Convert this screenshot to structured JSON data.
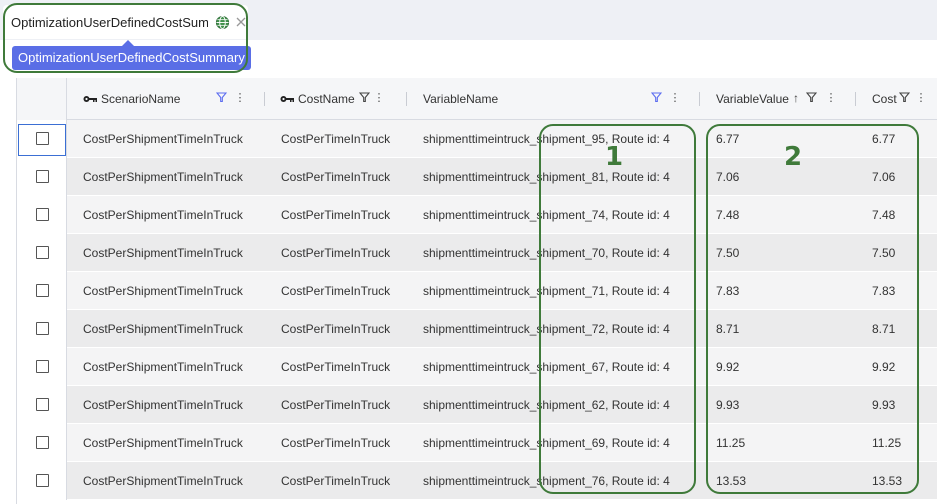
{
  "tab": {
    "title": "OptimizationUserDefinedCostSumr",
    "tooltip": "OptimizationUserDefinedCostSummary"
  },
  "columns": {
    "scenario": "ScenarioName",
    "cost_name": "CostName",
    "variable_name": "VariableName",
    "variable_value": "VariableValue",
    "cost": "Cost"
  },
  "icons": {
    "key": "key-icon",
    "filter": "filter-icon",
    "menu": "vertical-ellipsis-icon",
    "sort": "sort-ascending-icon",
    "globe": "globe-icon",
    "close": "close-icon"
  },
  "rows": [
    {
      "scenario": "CostPerShipmentTimeInTruck",
      "cost_name": "CostPerTimeInTruck",
      "variable_name": "shipmenttimeintruck_shipment_95, Route id: 4",
      "variable_value": "6.77",
      "cost": "6.77"
    },
    {
      "scenario": "CostPerShipmentTimeInTruck",
      "cost_name": "CostPerTimeInTruck",
      "variable_name": "shipmenttimeintruck_shipment_81, Route id: 4",
      "variable_value": "7.06",
      "cost": "7.06"
    },
    {
      "scenario": "CostPerShipmentTimeInTruck",
      "cost_name": "CostPerTimeInTruck",
      "variable_name": "shipmenttimeintruck_shipment_74, Route id: 4",
      "variable_value": "7.48",
      "cost": "7.48"
    },
    {
      "scenario": "CostPerShipmentTimeInTruck",
      "cost_name": "CostPerTimeInTruck",
      "variable_name": "shipmenttimeintruck_shipment_70, Route id: 4",
      "variable_value": "7.50",
      "cost": "7.50"
    },
    {
      "scenario": "CostPerShipmentTimeInTruck",
      "cost_name": "CostPerTimeInTruck",
      "variable_name": "shipmenttimeintruck_shipment_71, Route id: 4",
      "variable_value": "7.83",
      "cost": "7.83"
    },
    {
      "scenario": "CostPerShipmentTimeInTruck",
      "cost_name": "CostPerTimeInTruck",
      "variable_name": "shipmenttimeintruck_shipment_72, Route id: 4",
      "variable_value": "8.71",
      "cost": "8.71"
    },
    {
      "scenario": "CostPerShipmentTimeInTruck",
      "cost_name": "CostPerTimeInTruck",
      "variable_name": "shipmenttimeintruck_shipment_67, Route id: 4",
      "variable_value": "9.92",
      "cost": "9.92"
    },
    {
      "scenario": "CostPerShipmentTimeInTruck",
      "cost_name": "CostPerTimeInTruck",
      "variable_name": "shipmenttimeintruck_shipment_62, Route id: 4",
      "variable_value": "9.93",
      "cost": "9.93"
    },
    {
      "scenario": "CostPerShipmentTimeInTruck",
      "cost_name": "CostPerTimeInTruck",
      "variable_name": "shipmenttimeintruck_shipment_69, Route id: 4",
      "variable_value": "11.25",
      "cost": "11.25"
    },
    {
      "scenario": "CostPerShipmentTimeInTruck",
      "cost_name": "CostPerTimeInTruck",
      "variable_name": "shipmenttimeintruck_shipment_76, Route id: 4",
      "variable_value": "13.53",
      "cost": "13.53"
    }
  ],
  "annotations": {
    "callout_1": "1",
    "callout_2": "2"
  },
  "colors": {
    "annotation": "#3f7a3a",
    "tooltip": "#5a6ee6",
    "filter_active": "#5b6cf0"
  }
}
